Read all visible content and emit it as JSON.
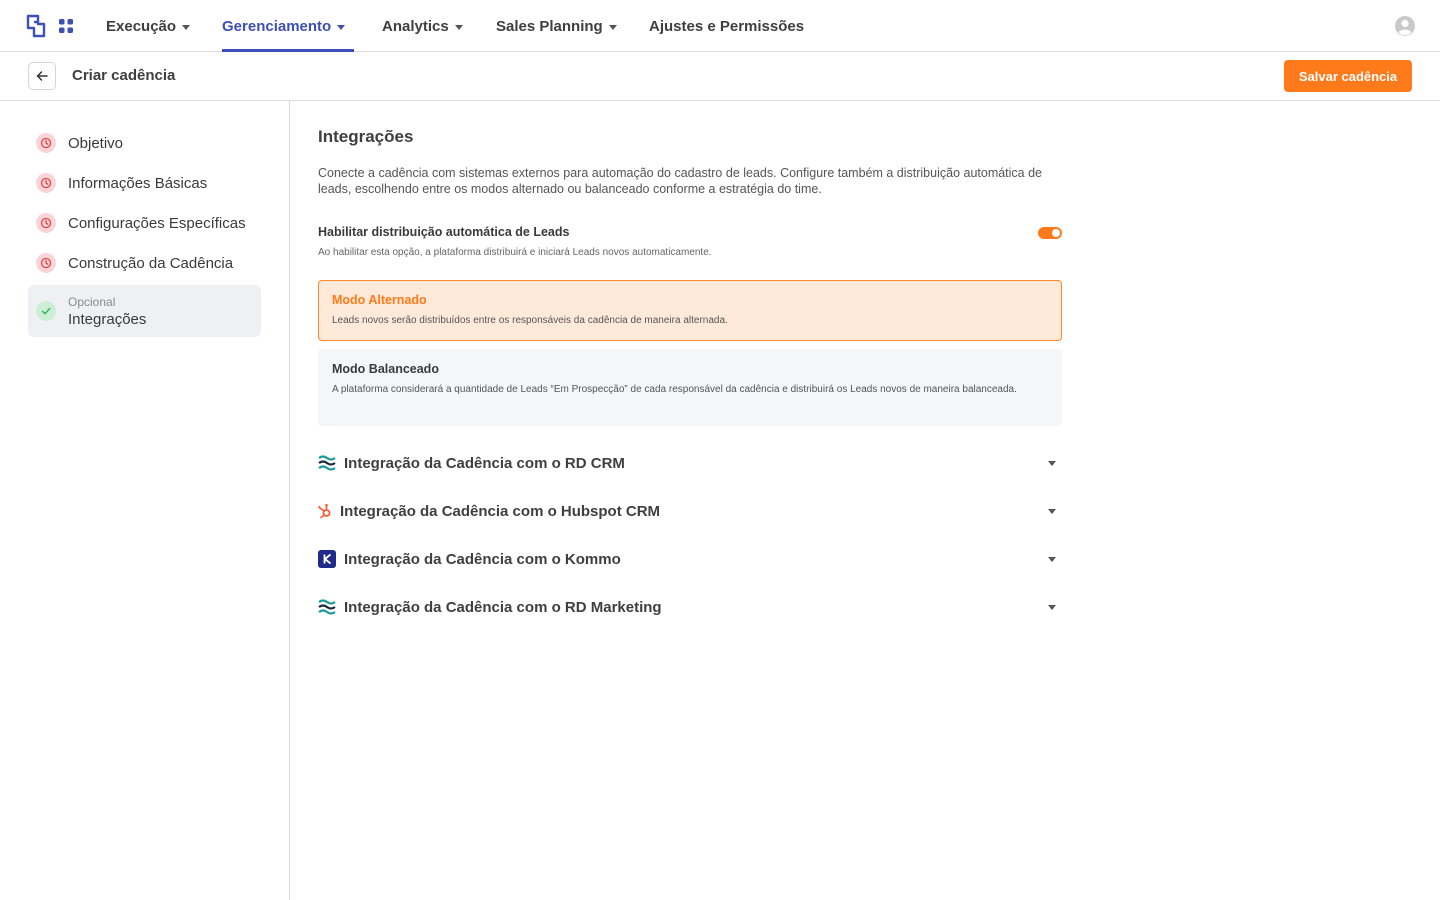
{
  "nav": {
    "items": [
      {
        "label": "Execução",
        "active": false
      },
      {
        "label": "Gerenciamento",
        "active": true
      },
      {
        "label": "Analytics",
        "active": false
      },
      {
        "label": "Sales Planning",
        "active": false
      },
      {
        "label": "Ajustes e Permissões",
        "active": false
      }
    ],
    "accent_color": "#3d4fb8"
  },
  "header": {
    "title": "Criar cadência",
    "save_label": "Salvar cadência",
    "save_color": "#ff7a1a"
  },
  "sidebar": {
    "steps": [
      {
        "label": "Objetivo",
        "status": "pending",
        "icon": "clock-icon"
      },
      {
        "label": "Informações Básicas",
        "status": "pending",
        "icon": "clock-icon"
      },
      {
        "label": "Configurações Específicas",
        "status": "pending",
        "icon": "clock-icon"
      },
      {
        "label": "Construção da Cadência",
        "status": "pending",
        "icon": "clock-icon"
      },
      {
        "label": "Integrações",
        "caption": "Opcional",
        "status": "done",
        "icon": "check-icon"
      }
    ]
  },
  "main": {
    "title": "Integrações",
    "description": "Conecte a cadência com sistemas externos para automação do cadastro de leads. Configure também a distribuição automática de leads, escolhendo entre os modos alternado ou balanceado conforme a estratégia do time.",
    "toggle": {
      "title": "Habilitar distribuição automática de Leads",
      "description": "Ao habilitar esta opção, a plataforma distribuirá e iniciará Leads novos automaticamente.",
      "enabled": true
    },
    "modes": [
      {
        "title": "Modo Alternado",
        "description": "Leads novos serão distribuídos entre os responsáveis da cadência de maneira alternada.",
        "selected": true
      },
      {
        "title": "Modo Balanceado",
        "description": "A plataforma considerará a quantidade de Leads “Em Prospecção” de cada responsável da cadência e distribuirá os Leads novos de maneira balanceada.",
        "selected": false
      }
    ],
    "integrations": [
      {
        "label": "Integração da Cadência com o RD CRM",
        "icon": "rd-station-icon"
      },
      {
        "label": "Integração da Cadência com o Hubspot CRM",
        "icon": "hubspot-icon"
      },
      {
        "label": "Integração da Cadência com o Kommo",
        "icon": "kommo-icon"
      },
      {
        "label": "Integração da Cadência com o RD Marketing",
        "icon": "rd-station-icon"
      }
    ]
  }
}
